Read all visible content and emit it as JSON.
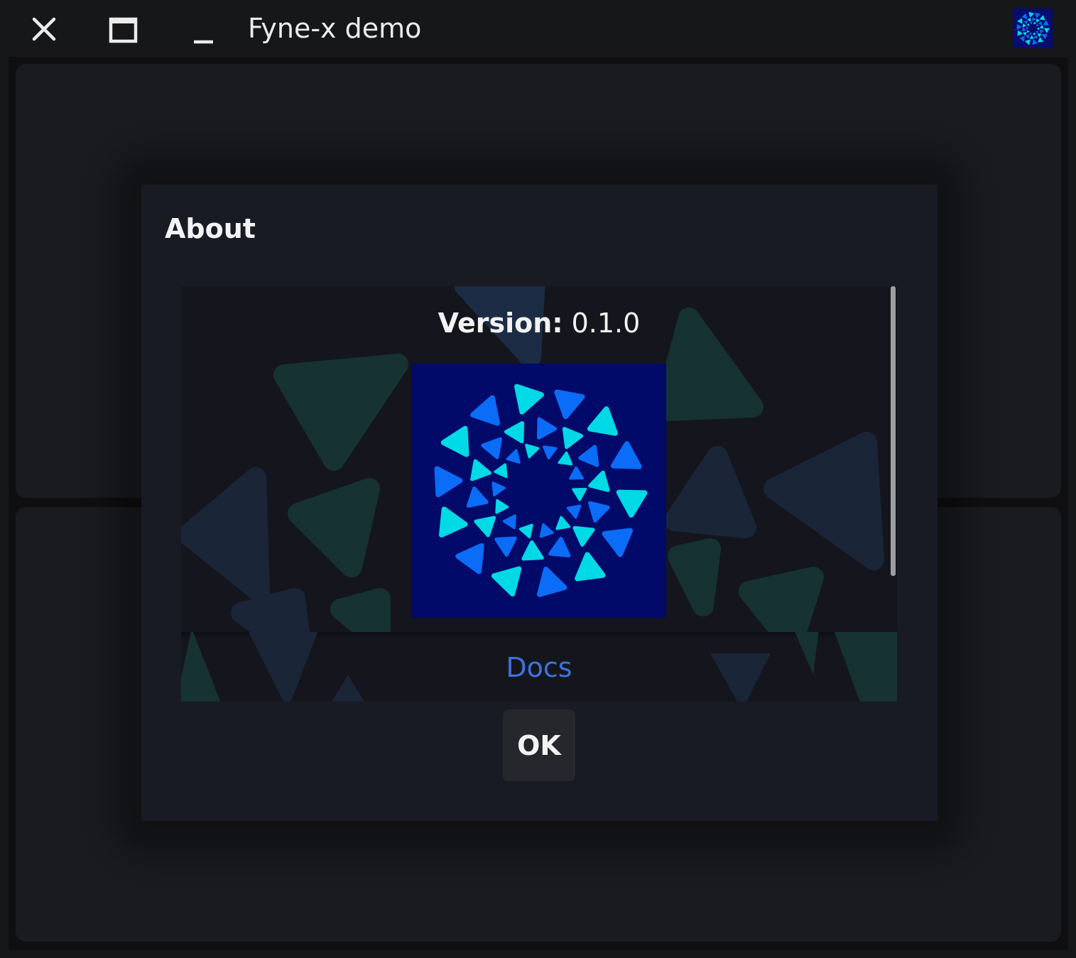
{
  "window": {
    "title": "Fyne-x demo",
    "buttons": {
      "close_icon": "close-icon",
      "maximize_icon": "maximize-icon",
      "minimize_icon": "minimize-icon"
    },
    "app_icon": "fyne-logo-icon"
  },
  "dialog": {
    "title": "About",
    "version_label": "Version:",
    "version_value": "0.1.0",
    "link_label": "Docs",
    "ok_label": "OK"
  },
  "colors": {
    "background": "#161719",
    "pane": "#1a1b1f",
    "dialog": "#181b23",
    "logo_background": "#020a69",
    "logo_cyan": "#00d9e6",
    "logo_blue": "#0a6cf7",
    "link": "#3d73d8"
  }
}
